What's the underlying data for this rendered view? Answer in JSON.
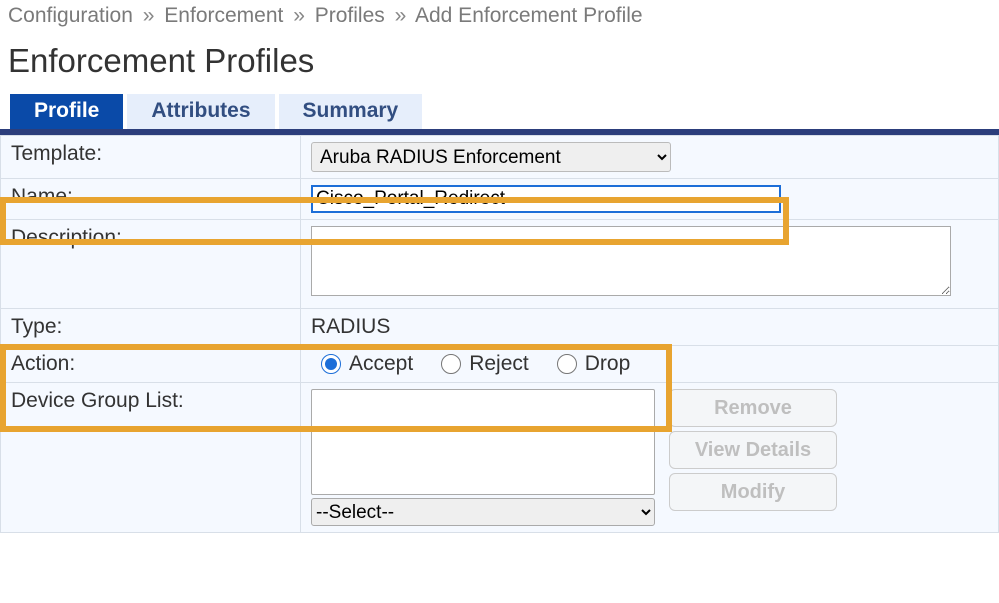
{
  "breadcrumb": {
    "items": [
      "Configuration",
      "Enforcement",
      "Profiles",
      "Add Enforcement Profile"
    ],
    "separator": "»"
  },
  "page_title": "Enforcement Profiles",
  "tabs": {
    "profile": "Profile",
    "attributes": "Attributes",
    "summary": "Summary"
  },
  "form": {
    "template": {
      "label": "Template:",
      "selected": "Aruba RADIUS Enforcement"
    },
    "name": {
      "label": "Name:",
      "value": "Cisco_Portal_Redirect"
    },
    "description": {
      "label": "Description:",
      "value": ""
    },
    "type": {
      "label": "Type:",
      "value": "RADIUS"
    },
    "action": {
      "label": "Action:",
      "options": {
        "accept": "Accept",
        "reject": "Reject",
        "drop": "Drop"
      },
      "selected": "accept"
    },
    "device_group_list": {
      "label": "Device Group List:",
      "buttons": {
        "remove": "Remove",
        "view_details": "View Details",
        "modify": "Modify"
      },
      "picker_placeholder": "--Select--"
    }
  }
}
